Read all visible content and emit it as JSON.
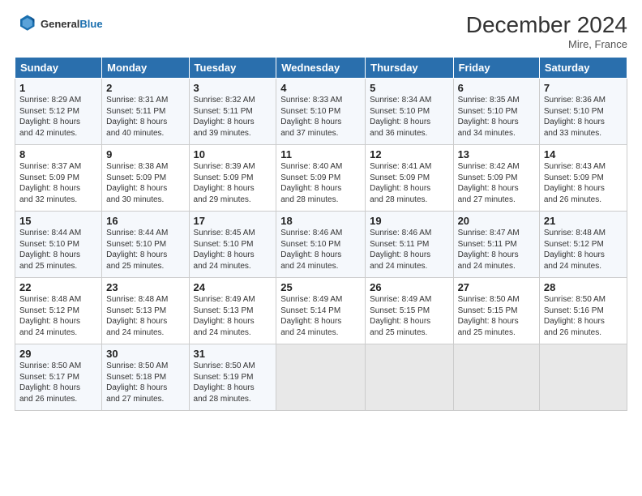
{
  "header": {
    "logo_line1": "General",
    "logo_line2": "Blue",
    "title": "December 2024",
    "location": "Mire, France"
  },
  "days_of_week": [
    "Sunday",
    "Monday",
    "Tuesday",
    "Wednesday",
    "Thursday",
    "Friday",
    "Saturday"
  ],
  "weeks": [
    [
      {
        "day": "1",
        "text": "Sunrise: 8:29 AM\nSunset: 5:12 PM\nDaylight: 8 hours\nand 42 minutes."
      },
      {
        "day": "2",
        "text": "Sunrise: 8:31 AM\nSunset: 5:11 PM\nDaylight: 8 hours\nand 40 minutes."
      },
      {
        "day": "3",
        "text": "Sunrise: 8:32 AM\nSunset: 5:11 PM\nDaylight: 8 hours\nand 39 minutes."
      },
      {
        "day": "4",
        "text": "Sunrise: 8:33 AM\nSunset: 5:10 PM\nDaylight: 8 hours\nand 37 minutes."
      },
      {
        "day": "5",
        "text": "Sunrise: 8:34 AM\nSunset: 5:10 PM\nDaylight: 8 hours\nand 36 minutes."
      },
      {
        "day": "6",
        "text": "Sunrise: 8:35 AM\nSunset: 5:10 PM\nDaylight: 8 hours\nand 34 minutes."
      },
      {
        "day": "7",
        "text": "Sunrise: 8:36 AM\nSunset: 5:10 PM\nDaylight: 8 hours\nand 33 minutes."
      }
    ],
    [
      {
        "day": "8",
        "text": "Sunrise: 8:37 AM\nSunset: 5:09 PM\nDaylight: 8 hours\nand 32 minutes."
      },
      {
        "day": "9",
        "text": "Sunrise: 8:38 AM\nSunset: 5:09 PM\nDaylight: 8 hours\nand 30 minutes."
      },
      {
        "day": "10",
        "text": "Sunrise: 8:39 AM\nSunset: 5:09 PM\nDaylight: 8 hours\nand 29 minutes."
      },
      {
        "day": "11",
        "text": "Sunrise: 8:40 AM\nSunset: 5:09 PM\nDaylight: 8 hours\nand 28 minutes."
      },
      {
        "day": "12",
        "text": "Sunrise: 8:41 AM\nSunset: 5:09 PM\nDaylight: 8 hours\nand 28 minutes."
      },
      {
        "day": "13",
        "text": "Sunrise: 8:42 AM\nSunset: 5:09 PM\nDaylight: 8 hours\nand 27 minutes."
      },
      {
        "day": "14",
        "text": "Sunrise: 8:43 AM\nSunset: 5:09 PM\nDaylight: 8 hours\nand 26 minutes."
      }
    ],
    [
      {
        "day": "15",
        "text": "Sunrise: 8:44 AM\nSunset: 5:10 PM\nDaylight: 8 hours\nand 25 minutes."
      },
      {
        "day": "16",
        "text": "Sunrise: 8:44 AM\nSunset: 5:10 PM\nDaylight: 8 hours\nand 25 minutes."
      },
      {
        "day": "17",
        "text": "Sunrise: 8:45 AM\nSunset: 5:10 PM\nDaylight: 8 hours\nand 24 minutes."
      },
      {
        "day": "18",
        "text": "Sunrise: 8:46 AM\nSunset: 5:10 PM\nDaylight: 8 hours\nand 24 minutes."
      },
      {
        "day": "19",
        "text": "Sunrise: 8:46 AM\nSunset: 5:11 PM\nDaylight: 8 hours\nand 24 minutes."
      },
      {
        "day": "20",
        "text": "Sunrise: 8:47 AM\nSunset: 5:11 PM\nDaylight: 8 hours\nand 24 minutes."
      },
      {
        "day": "21",
        "text": "Sunrise: 8:48 AM\nSunset: 5:12 PM\nDaylight: 8 hours\nand 24 minutes."
      }
    ],
    [
      {
        "day": "22",
        "text": "Sunrise: 8:48 AM\nSunset: 5:12 PM\nDaylight: 8 hours\nand 24 minutes."
      },
      {
        "day": "23",
        "text": "Sunrise: 8:48 AM\nSunset: 5:13 PM\nDaylight: 8 hours\nand 24 minutes."
      },
      {
        "day": "24",
        "text": "Sunrise: 8:49 AM\nSunset: 5:13 PM\nDaylight: 8 hours\nand 24 minutes."
      },
      {
        "day": "25",
        "text": "Sunrise: 8:49 AM\nSunset: 5:14 PM\nDaylight: 8 hours\nand 24 minutes."
      },
      {
        "day": "26",
        "text": "Sunrise: 8:49 AM\nSunset: 5:15 PM\nDaylight: 8 hours\nand 25 minutes."
      },
      {
        "day": "27",
        "text": "Sunrise: 8:50 AM\nSunset: 5:15 PM\nDaylight: 8 hours\nand 25 minutes."
      },
      {
        "day": "28",
        "text": "Sunrise: 8:50 AM\nSunset: 5:16 PM\nDaylight: 8 hours\nand 26 minutes."
      }
    ],
    [
      {
        "day": "29",
        "text": "Sunrise: 8:50 AM\nSunset: 5:17 PM\nDaylight: 8 hours\nand 26 minutes."
      },
      {
        "day": "30",
        "text": "Sunrise: 8:50 AM\nSunset: 5:18 PM\nDaylight: 8 hours\nand 27 minutes."
      },
      {
        "day": "31",
        "text": "Sunrise: 8:50 AM\nSunset: 5:19 PM\nDaylight: 8 hours\nand 28 minutes."
      },
      null,
      null,
      null,
      null
    ]
  ]
}
